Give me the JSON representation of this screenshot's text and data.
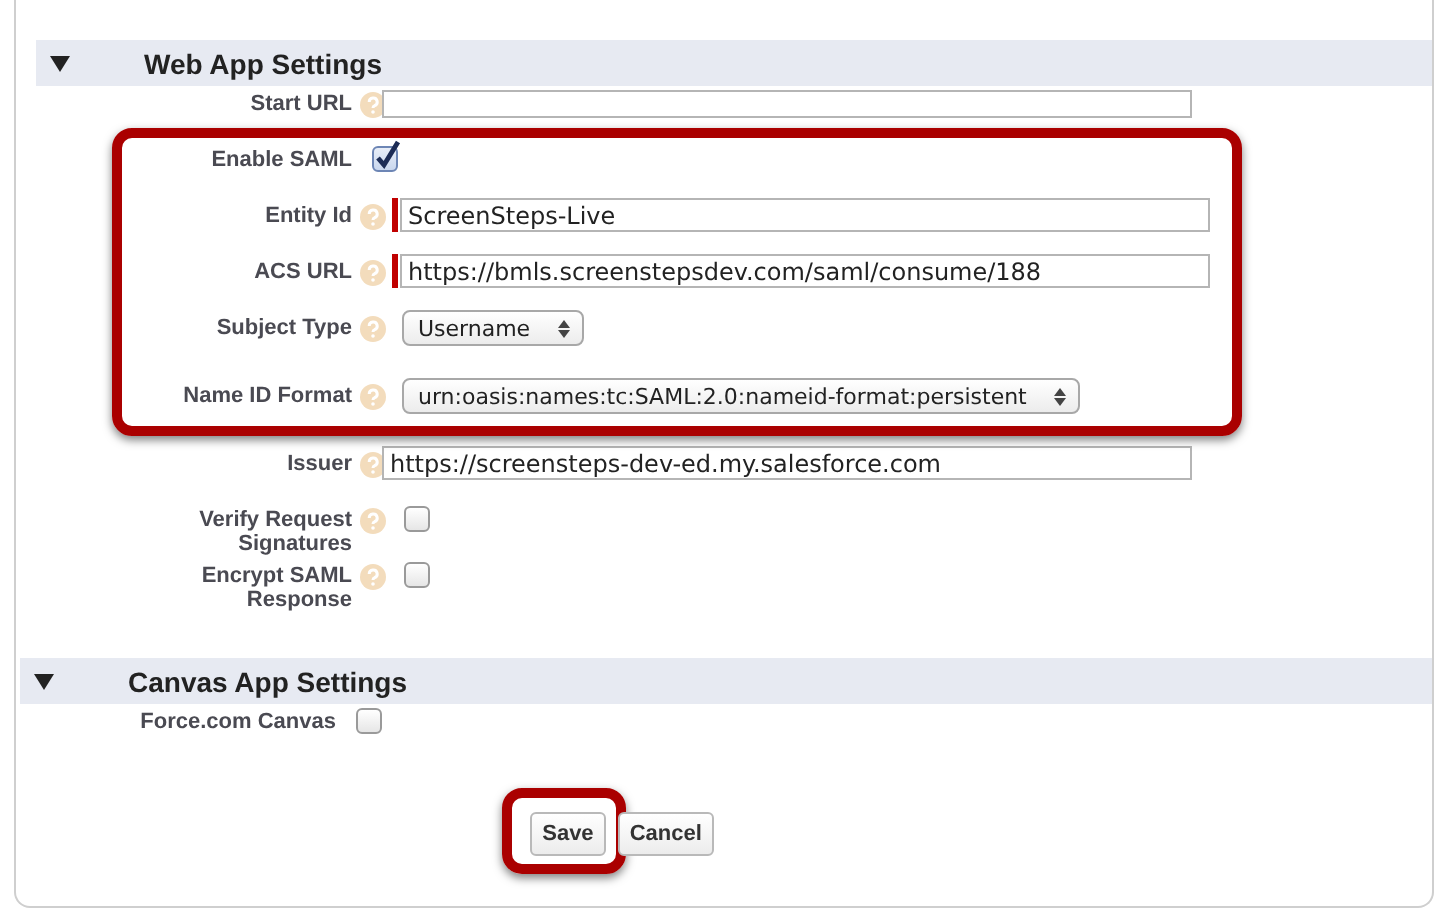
{
  "sections": [
    {
      "title": "Web App Settings",
      "expanded": true,
      "fields": [
        {
          "kind": "text",
          "label": "Start URL",
          "help": true,
          "required": false
        },
        {
          "kind": "checkbox",
          "label": "Enable SAML",
          "help": false,
          "checked": true
        },
        {
          "kind": "text",
          "label": "Entity Id",
          "help": true,
          "required": true,
          "value": "ScreenSteps-Live"
        },
        {
          "kind": "text",
          "label": "ACS URL",
          "help": true,
          "required": true,
          "value": "https://bmls.screenstepsdev.com/saml/consume/188"
        },
        {
          "kind": "select",
          "label": "Subject Type",
          "help": true,
          "value": "Username"
        },
        {
          "kind": "select",
          "label": "Name ID Format",
          "help": true,
          "value": "urn:oasis:names:tc:SAML:2.0:nameid-format:persistent"
        },
        {
          "kind": "text",
          "label": "Issuer",
          "help": true,
          "required": false,
          "value": "https://screensteps-dev-ed.my.salesforce.com"
        },
        {
          "kind": "checkbox",
          "label": "Verify Request Signatures",
          "help": true,
          "checked": false
        },
        {
          "kind": "checkbox",
          "label": "Encrypt SAML Response",
          "help": true,
          "checked": false
        }
      ]
    },
    {
      "title": "Canvas App Settings",
      "expanded": true,
      "fields": [
        {
          "kind": "checkbox",
          "label": "Force.com Canvas",
          "help": false,
          "checked": false
        }
      ]
    }
  ],
  "buttons": [
    {
      "label": "Save",
      "highlighted": true
    },
    {
      "label": "Cancel",
      "highlighted": false
    }
  ]
}
